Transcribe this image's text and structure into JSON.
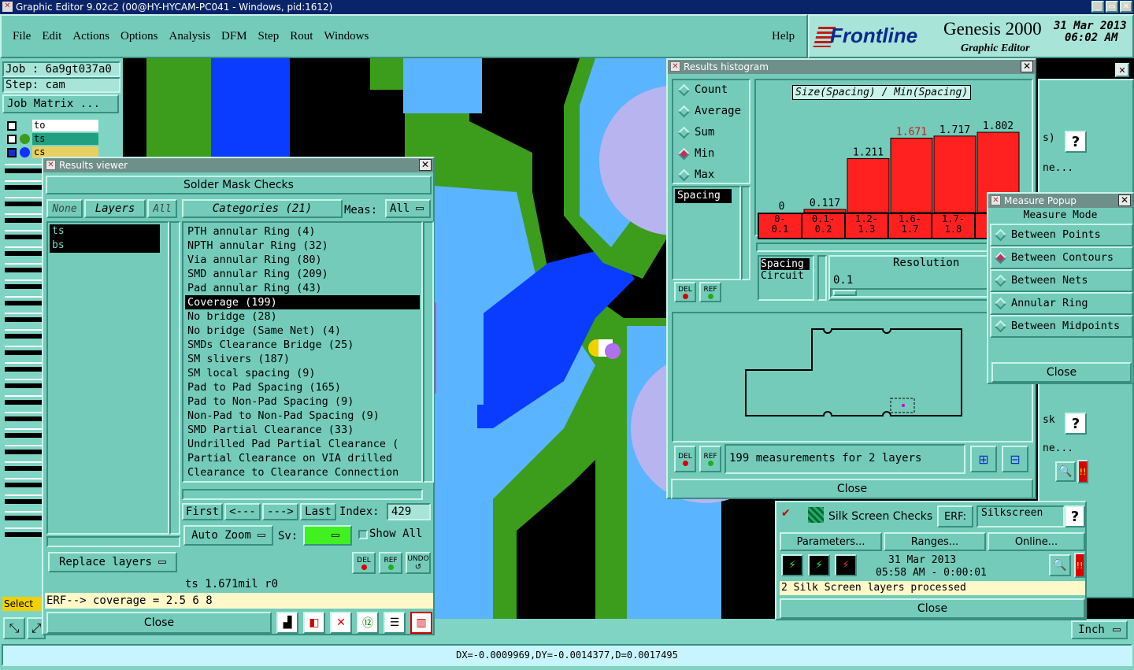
{
  "app": {
    "title": "Graphic Editor 9.02c2 (00@HY-HYCAM-PC041 - Windows, pid:1612)",
    "win_btns": [
      "_",
      "▭",
      "✕"
    ]
  },
  "menu": {
    "items": [
      "File",
      "Edit",
      "Actions",
      "Options",
      "Analysis",
      "DFM",
      "Step",
      "Rout",
      "Windows"
    ],
    "help": "Help"
  },
  "brand": {
    "logo": "Frontline",
    "product": "Genesis 2000",
    "subtitle": "Graphic Editor",
    "date": "31 Mar 2013",
    "time": "06:02 AM"
  },
  "job": {
    "job": "Job : 6a9gt037a0",
    "step": "Step: cam",
    "matrix_btn": "Job Matrix ..."
  },
  "layers": [
    {
      "name": "to",
      "style": "white"
    },
    {
      "name": "ts",
      "style": "teal"
    },
    {
      "name": "cs",
      "style": "yellow"
    }
  ],
  "results_viewer": {
    "title": "Results viewer",
    "heading": "Solder Mask Checks",
    "none_btn": "None",
    "layers_btn": "Layers",
    "all_btn": "All",
    "layer_list": [
      "ts",
      "bs"
    ],
    "categories_btn": "Categories (21)",
    "meas_label": "Meas:",
    "meas_value": "All",
    "categories": [
      "PTH annular Ring (4)",
      "NPTH annular Ring (32)",
      "Via annular Ring (80)",
      "SMD annular Ring (209)",
      "Pad annular Ring (43)",
      "Coverage (199)",
      "No bridge (28)",
      "No bridge (Same Net) (4)",
      "SMDs Clearance Bridge (25)",
      "SM slivers (187)",
      "SM local spacing (9)",
      "Pad to Pad Spacing (165)",
      "Pad to Non-Pad Spacing (9)",
      "Non-Pad to Non-Pad Spacing (9)",
      "SMD Partial Clearance (33)",
      "Undrilled Pad Partial Clearance (",
      "Partial Clearance on VIA drilled",
      "Clearance to Clearance Connection"
    ],
    "selected_index": 5,
    "first_btn": "First",
    "prev_btn": "<---",
    "next_btn": "--->",
    "last_btn": "Last",
    "index_label": "Index:",
    "index_value": "429",
    "autozoom": "Auto Zoom",
    "sv_label": "Sv:",
    "show_all": "Show All",
    "replace_layers": "Replace layers",
    "del": "DEL",
    "ref": "REF",
    "undo": "UNDO",
    "status": "ts  1.671mil  r0",
    "erf_line": "ERF--> coverage = 2.5 6 8",
    "close": "Close"
  },
  "histogram": {
    "title": "Results histogram",
    "options": [
      "Count",
      "Average",
      "Sum",
      "Min",
      "Max"
    ],
    "selected_option": 3,
    "list_item": "Spacing",
    "chart_title": "Size(Spacing) / Min(Spacing)",
    "bins": [
      "0-\n0.1",
      "0.1-\n0.2",
      "1.2-\n1.3",
      "1.6-\n1.7",
      "1.7-\n1.8"
    ],
    "bin_lines": [
      [
        "0-",
        "0.1"
      ],
      [
        "0.1-",
        "0.2"
      ],
      [
        "1.2-",
        "1.3"
      ],
      [
        "1.6-",
        "1.7"
      ],
      [
        "1.7-",
        "1.8"
      ]
    ],
    "spacing_list": [
      "Spacing",
      "Circuit"
    ],
    "resolution_label": "Resolution",
    "resolution_value": "0.1",
    "measurements": "199 measurements for 2 layers",
    "close": "Close",
    "chart_data": {
      "type": "bar",
      "title": "Size(Spacing) / Min(Spacing)",
      "categories": [
        "0-0.1",
        "0.1-0.2",
        "1.2-1.3",
        "1.6-1.7",
        "1.7-1.8",
        ""
      ],
      "values": [
        0,
        0.117,
        1.211,
        1.671,
        1.717,
        1.802
      ],
      "labels": [
        "0",
        "0.117",
        "1.211",
        "1.671",
        "1.717",
        "1.802"
      ],
      "highlight_index": 3,
      "colors": {
        "bar": "#ff2020",
        "highlight_label": "#d01818"
      }
    }
  },
  "measure": {
    "title": "Measure Popup",
    "heading": "Measure Mode",
    "options": [
      "Between Points",
      "Between Contours",
      "Between Nets",
      "Annular Ring",
      "Between Midpoints"
    ],
    "selected": 1,
    "close": "Close"
  },
  "silk": {
    "title": "Silk Screen Checks",
    "erf_label": "ERF:",
    "erf_value": "Silkscreen",
    "help": "?",
    "params": "Parameters...",
    "ranges": "Ranges...",
    "online": "Online...",
    "date": "31 Mar 2013",
    "time": "05:58 AM - 0:00:01",
    "status": "2 Silk Screen layers processed",
    "close": "Close"
  },
  "side_panel": {
    "s_label": "s)",
    "ne1": "ne...",
    "sk": "sk",
    "ne2": "ne...",
    "help": "?"
  },
  "bottom": {
    "units": "Inch",
    "coords": "DX=-0.0009969,DY=-0.0014377,D=0.0017495",
    "select_label": "Select"
  },
  "colors": {
    "bg": "#7fd4c4",
    "panel": "#74cbb9",
    "canvas": "#000000",
    "green": "#3c9c1c",
    "blue": "#0a3cff",
    "lightblue": "#5ab4ff",
    "lavender": "#b8b4f0",
    "magenta": "#ff33ff",
    "bar": "#ff2020"
  }
}
